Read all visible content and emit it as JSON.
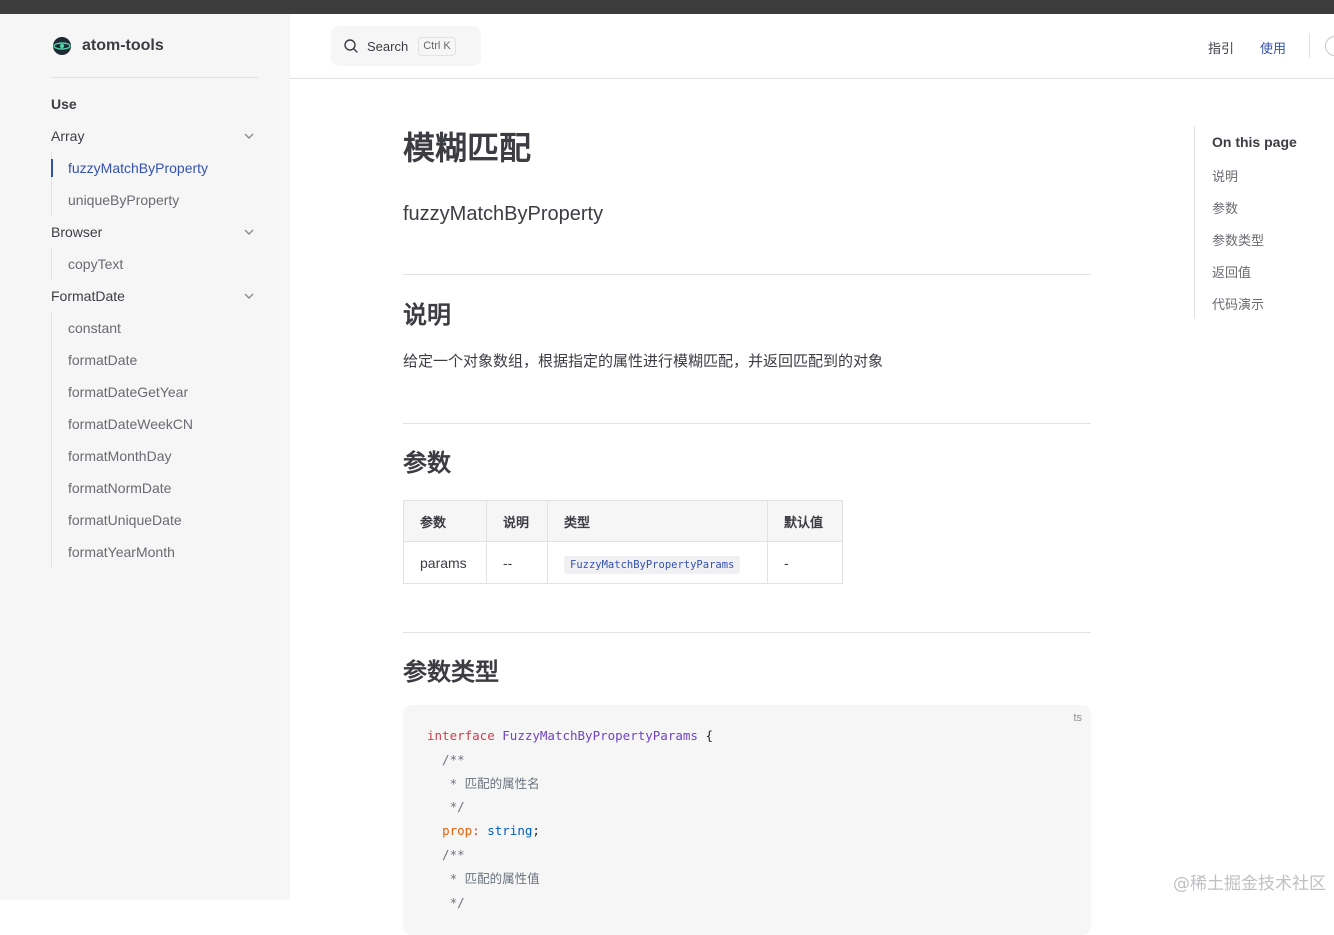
{
  "brand": {
    "name": "atom-tools"
  },
  "search": {
    "label": "Search",
    "shortcut": "Ctrl K"
  },
  "topnav": {
    "links": [
      "指引",
      "使用"
    ]
  },
  "sidebar": {
    "section": "Use",
    "groups": [
      {
        "label": "Array",
        "items": [
          "fuzzyMatchByProperty",
          "uniqueByProperty"
        ]
      },
      {
        "label": "Browser",
        "items": [
          "copyText"
        ]
      },
      {
        "label": "FormatDate",
        "items": [
          "constant",
          "formatDate",
          "formatDateGetYear",
          "formatDateWeekCN",
          "formatMonthDay",
          "formatNormDate",
          "formatUniqueDate",
          "formatYearMonth"
        ]
      }
    ],
    "active_item": "fuzzyMatchByProperty"
  },
  "main": {
    "title": "模糊匹配",
    "subtitle": "fuzzyMatchByProperty",
    "sections": {
      "desc_heading": "说明",
      "desc_text": "给定一个对象数组，根据指定的属性进行模糊匹配，并返回匹配到的对象",
      "params_heading": "参数",
      "types_heading": "参数类型"
    },
    "table": {
      "headers": [
        "参数",
        "说明",
        "类型",
        "默认值"
      ],
      "rows": [
        [
          "params",
          "--",
          "FuzzyMatchByPropertyParams",
          "-"
        ]
      ]
    },
    "code": {
      "lang": "ts",
      "lines": [
        "interface FuzzyMatchByPropertyParams {",
        "  /**",
        "   * 匹配的属性名",
        "   */",
        "  prop: string;",
        "  /**",
        "   * 匹配的属性值",
        "   */"
      ]
    }
  },
  "aside": {
    "title": "On this page",
    "links": [
      "说明",
      "参数",
      "参数类型",
      "返回值",
      "代码演示"
    ]
  },
  "watermark": "@稀土掘金技术社区",
  "colors": {
    "accent": "#3451b2",
    "sidebar_bg": "#f6f6f7",
    "topbar": "#3c3c3c"
  }
}
